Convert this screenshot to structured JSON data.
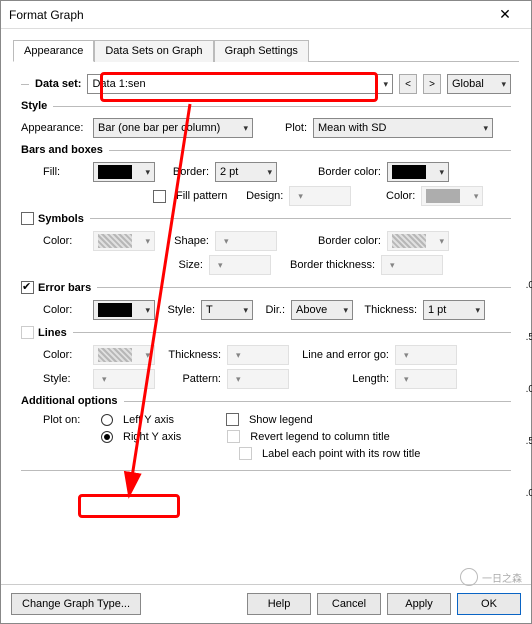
{
  "title": "Format Graph",
  "tabs": {
    "appearance": "Appearance",
    "datasets": "Data Sets on Graph",
    "settings": "Graph Settings"
  },
  "dataset": {
    "label": "Data set:",
    "value": "Data 1:sen",
    "global": "Global",
    "nav_back": "<",
    "nav_fwd": ">"
  },
  "style": {
    "heading": "Style",
    "appearance_label": "Appearance:",
    "appearance_value": "Bar (one bar per column)",
    "plot_label": "Plot:",
    "plot_value": "Mean with SD"
  },
  "bars": {
    "heading": "Bars and boxes",
    "fill_label": "Fill:",
    "border_label": "Border:",
    "border_value": "2 pt",
    "bordercolor_label": "Border color:",
    "fillpattern_label": "Fill pattern",
    "design_label": "Design:",
    "color_label": "Color:"
  },
  "symbols": {
    "heading": "Symbols",
    "color_label": "Color:",
    "shape_label": "Shape:",
    "size_label": "Size:",
    "bordercolor_label": "Border color:",
    "borderthick_label": "Border thickness:"
  },
  "errorbars": {
    "heading": "Error bars",
    "color_label": "Color:",
    "style_label": "Style:",
    "style_value": "T",
    "dir_label": "Dir.:",
    "dir_value": "Above",
    "thick_label": "Thickness:",
    "thick_value": "1 pt"
  },
  "lines": {
    "heading": "Lines",
    "color_label": "Color:",
    "style_label": "Style:",
    "thick_label": "Thickness:",
    "pattern_label": "Pattern:",
    "go_label": "Line and error go:",
    "length_label": "Length:"
  },
  "addl": {
    "heading": "Additional options",
    "ploton_label": "Plot on:",
    "lefty": "Left Y axis",
    "righty": "Right Y axis",
    "showlegend": "Show legend",
    "revert": "Revert legend to column title",
    "labeleach": "Label each point with its row title"
  },
  "footer": {
    "change": "Change Graph Type...",
    "help": "Help",
    "cancel": "Cancel",
    "apply": "Apply",
    "ok": "OK"
  }
}
